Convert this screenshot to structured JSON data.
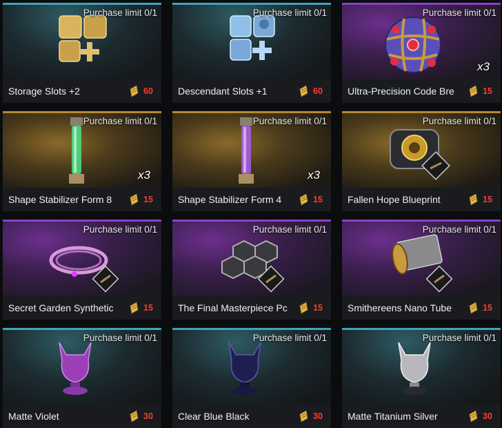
{
  "colors": {
    "teal": "#3ea6b8",
    "purple": "#8a3fcf",
    "gold": "#b78a2e",
    "price": "#ff3b30",
    "currency": "#e8b84a"
  },
  "items": [
    {
      "name": "Storage Slots +2",
      "limit": "Purchase limit 0/1",
      "price": "60",
      "qty": "",
      "icon": "storage-slots-icon"
    },
    {
      "name": "Descendant Slots +1",
      "limit": "Purchase limit 0/1",
      "price": "60",
      "qty": "",
      "icon": "descendant-slots-icon"
    },
    {
      "name": "Ultra-Precision Code Bre",
      "limit": "Purchase limit 0/1",
      "price": "15",
      "qty": "x3",
      "icon": "code-breaker-orb-icon"
    },
    {
      "name": "Shape Stabilizer Form 8",
      "limit": "Purchase limit 0/1",
      "price": "15",
      "qty": "x3",
      "icon": "green-stabilizer-tube-icon"
    },
    {
      "name": "Shape Stabilizer Form 4",
      "limit": "Purchase limit 0/1",
      "price": "15",
      "qty": "x3",
      "icon": "purple-stabilizer-tube-icon"
    },
    {
      "name": "Fallen Hope Blueprint",
      "limit": "Purchase limit 0/1",
      "price": "15",
      "qty": "",
      "icon": "blueprint-device-icon"
    },
    {
      "name": "Secret Garden Synthetic",
      "limit": "Purchase limit 0/1",
      "price": "15",
      "qty": "",
      "icon": "synthetic-coil-icon"
    },
    {
      "name": "The Final Masterpiece Pc",
      "limit": "Purchase limit 0/1",
      "price": "15",
      "qty": "",
      "icon": "hexagon-tray-icon"
    },
    {
      "name": "Smithereens Nano Tube",
      "limit": "Purchase limit 0/1",
      "price": "15",
      "qty": "",
      "icon": "nano-tube-roll-icon"
    },
    {
      "name": "Matte Violet",
      "limit": "Purchase limit 0/1",
      "price": "30",
      "qty": "",
      "icon": "violet-paint-bust-icon"
    },
    {
      "name": "Clear Blue Black",
      "limit": "Purchase limit 0/1",
      "price": "30",
      "qty": "",
      "icon": "blue-black-paint-bust-icon"
    },
    {
      "name": "Matte Titanium Silver",
      "limit": "Purchase limit 0/1",
      "price": "30",
      "qty": "",
      "icon": "silver-paint-bust-icon"
    }
  ]
}
